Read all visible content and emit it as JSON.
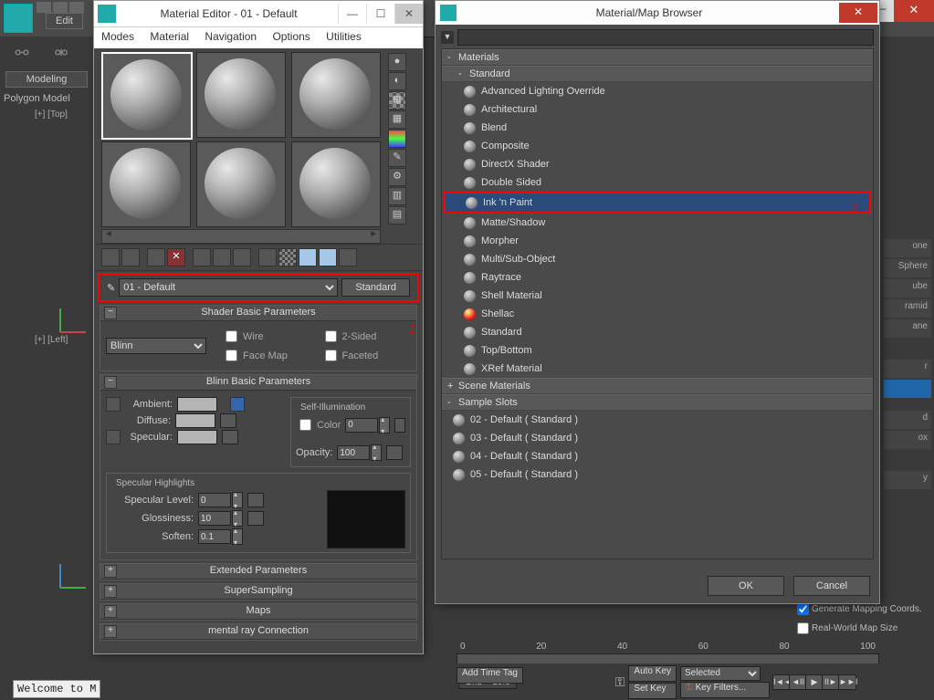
{
  "main_app": {
    "edit_label": "Edit",
    "modeling_btn": "Modeling",
    "polygon_label": "Polygon Model",
    "viewport_top": "[+] [Top]",
    "viewport_left": "[+] [Left]",
    "welcome": "Welcome to M",
    "timeline_ticks": [
      "0",
      "20",
      "40",
      "60",
      "80",
      "100"
    ],
    "grid": "Grid = 10.0",
    "add_time_tag": "Add Time Tag",
    "autokey": "Auto Key",
    "setkey": "Set Key",
    "key_selected": "Selected",
    "key_filters": "Key Filters...",
    "gen_mapping": "Generate Mapping Coords.",
    "real_world": "Real-World Map Size",
    "right_labels": [
      "one",
      "Sphere",
      "ube",
      "ramid",
      "ane",
      "r",
      "d",
      "ox",
      "y"
    ]
  },
  "material_editor": {
    "title": "Material Editor - 01 - Default",
    "menus": [
      "Modes",
      "Material",
      "Navigation",
      "Options",
      "Utilities"
    ],
    "slot_name": "01 - Default",
    "type_btn": "Standard",
    "annotation1": "1",
    "rollouts": {
      "shader_basic": "Shader Basic Parameters",
      "blinn_basic": "Blinn Basic Parameters",
      "extended": "Extended Parameters",
      "supersampling": "SuperSampling",
      "maps": "Maps",
      "mentalray": "mental ray Connection"
    },
    "shader": {
      "type": "Blinn",
      "wire": "Wire",
      "two_sided": "2-Sided",
      "face_map": "Face Map",
      "faceted": "Faceted"
    },
    "blinn": {
      "ambient": "Ambient:",
      "diffuse": "Diffuse:",
      "specular": "Specular:",
      "self_illum": "Self-Illumination",
      "color": "Color",
      "color_val": "0",
      "opacity": "Opacity:",
      "opacity_val": "100",
      "spec_hl": "Specular Highlights",
      "spec_level": "Specular Level:",
      "spec_level_val": "0",
      "gloss": "Glossiness:",
      "gloss_val": "10",
      "soften": "Soften:",
      "soften_val": "0.1"
    }
  },
  "map_browser": {
    "title": "Material/Map Browser",
    "annotation2": "2",
    "groups": {
      "materials": "Materials",
      "standard": "Standard",
      "scene_materials": "Scene Materials",
      "sample_slots": "Sample Slots"
    },
    "materials": [
      "Advanced Lighting Override",
      "Architectural",
      "Blend",
      "Composite",
      "DirectX Shader",
      "Double Sided",
      "Ink 'n Paint",
      "Matte/Shadow",
      "Morpher",
      "Multi/Sub-Object",
      "Raytrace",
      "Shell Material",
      "Shellac",
      "Standard",
      "Top/Bottom",
      "XRef Material"
    ],
    "selected_material": "Ink 'n Paint",
    "shellac_red": "Shellac",
    "sample_slots": [
      "02 - Default  ( Standard )",
      "03 - Default  ( Standard )",
      "04 - Default  ( Standard )",
      "05 - Default  ( Standard )"
    ],
    "ok": "OK",
    "cancel": "Cancel"
  }
}
